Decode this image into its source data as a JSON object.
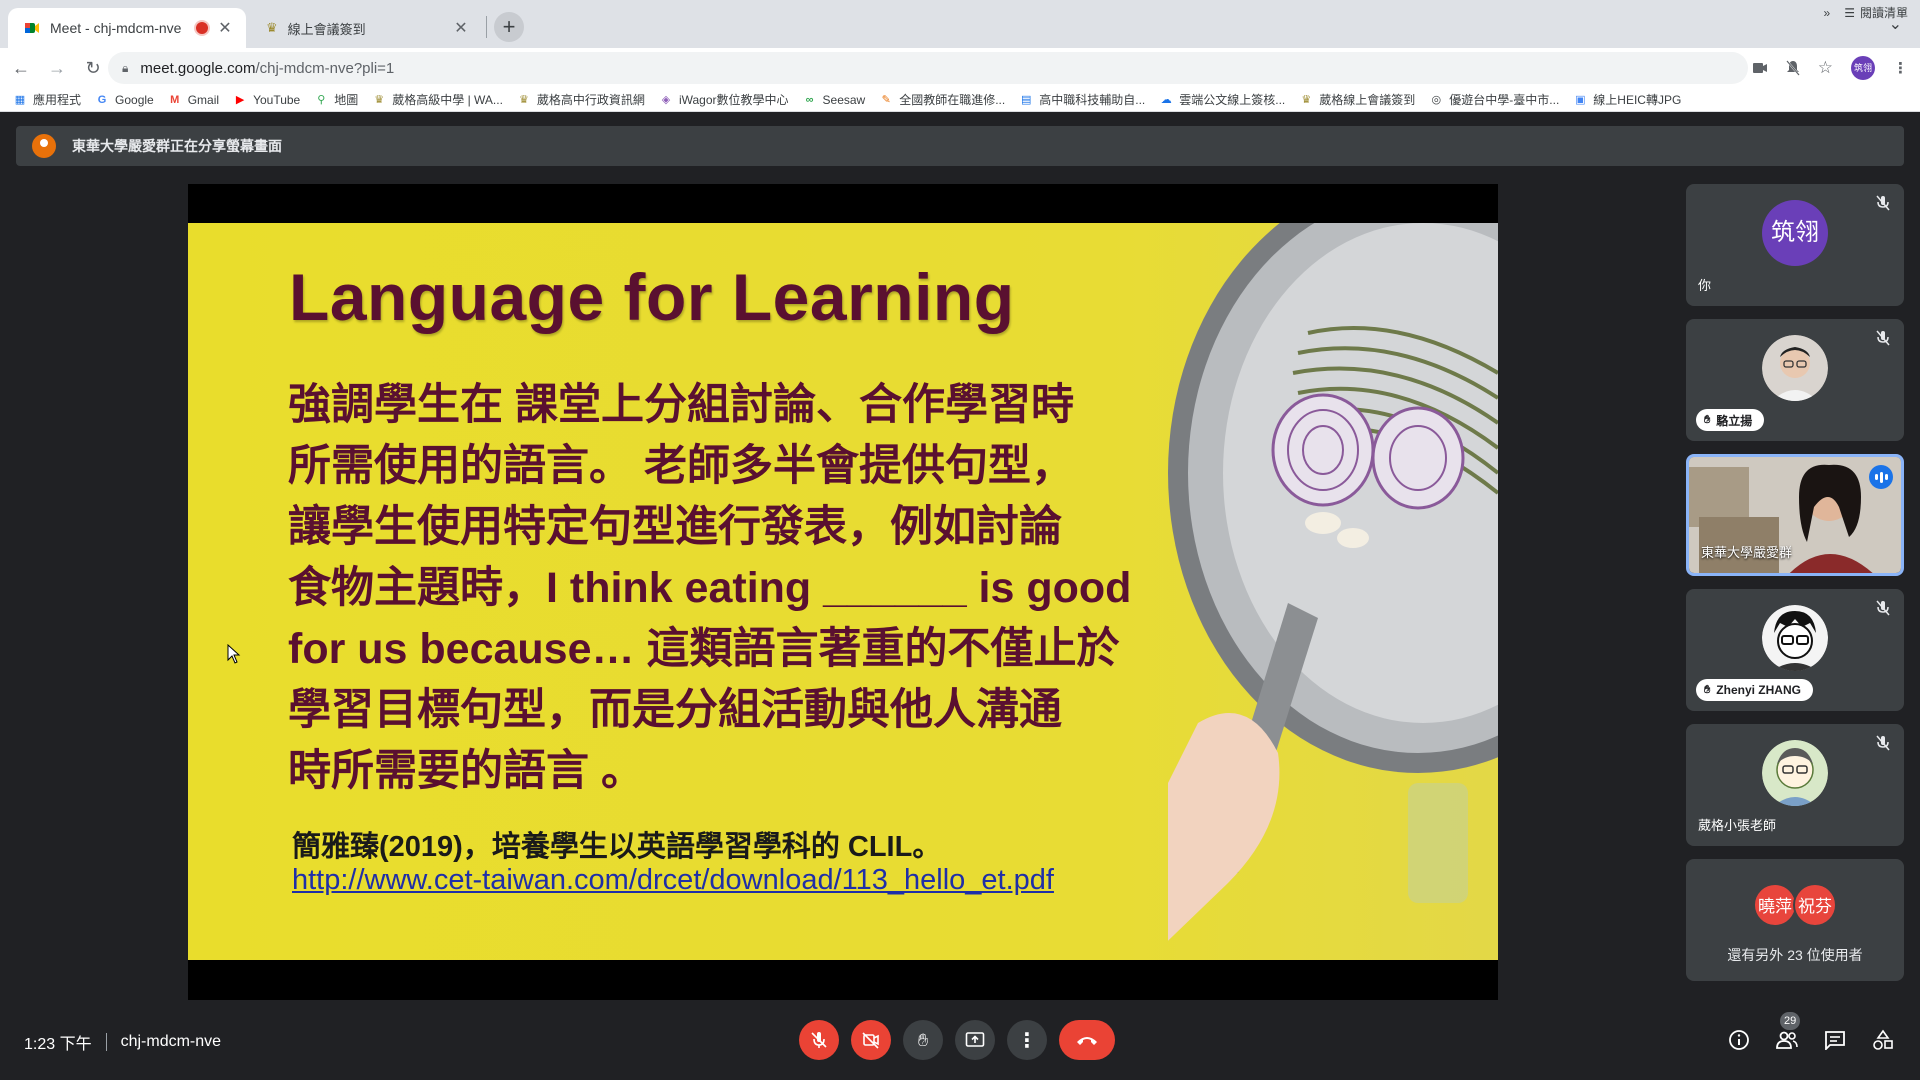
{
  "browser": {
    "tabs": [
      {
        "title": "Meet - chj-mdcm-nve",
        "active": true,
        "recording": true
      },
      {
        "title": "線上會議簽到",
        "active": false
      }
    ],
    "url_host": "meet.google.com",
    "url_path": "/chj-mdcm-nve?pli=1",
    "profile_label": "筑翎",
    "bookmarks": [
      {
        "label": "應用程式",
        "icon": "apps-grid-icon",
        "color": "#1a73e8"
      },
      {
        "label": "Google",
        "icon": "google-icon",
        "color": "#4285f4"
      },
      {
        "label": "Gmail",
        "icon": "gmail-icon",
        "color": "#ea4335"
      },
      {
        "label": "YouTube",
        "icon": "youtube-icon",
        "color": "#ff0000"
      },
      {
        "label": "地圖",
        "icon": "maps-icon",
        "color": "#34a853"
      },
      {
        "label": "葳格高級中學 | WA...",
        "icon": "school-icon",
        "color": "#9c8a2e"
      },
      {
        "label": "葳格高中行政資訊網",
        "icon": "school-icon",
        "color": "#9c8a2e"
      },
      {
        "label": "iWagor數位教學中心",
        "icon": "iwagor-icon",
        "color": "#8e5fb8"
      },
      {
        "label": "Seesaw",
        "icon": "seesaw-icon",
        "color": "#34a853"
      },
      {
        "label": "全國教師在職進修...",
        "icon": "teacher-icon",
        "color": "#e8710a"
      },
      {
        "label": "高中職科技輔助自...",
        "icon": "doc-icon",
        "color": "#1a73e8"
      },
      {
        "label": "雲端公文線上簽核...",
        "icon": "cloud-doc-icon",
        "color": "#1a73e8"
      },
      {
        "label": "葳格線上會議簽到",
        "icon": "school-icon",
        "color": "#9c8a2e"
      },
      {
        "label": "優遊台中學-臺中市...",
        "icon": "globe-icon",
        "color": "#3c4043"
      },
      {
        "label": "線上HEIC轉JPG",
        "icon": "image-convert-icon",
        "color": "#4285f4"
      }
    ],
    "more_bookmarks": "»",
    "reading_list": "閱讀清單"
  },
  "meet": {
    "presenting_banner": "東華大學嚴愛群正在分享螢幕畫面",
    "slide": {
      "title": "Language for Learning",
      "body": "強調學生在 課堂上分組討論、合作學習時\n所需使用的語言。 老師多半會提供句型，\n讓學生使用特定句型進行發表，例如討論\n食物主題時，I think eating ______ is good\nfor us because… 這類語言著重的不僅止於\n學習目標句型，而是分組活動與他人溝通\n時所需要的語言 。",
      "citation": "簡雅臻(2019)，培養學生以英語學習學科的 CLIL。",
      "link": "http://www.cet-taiwan.com/drcet/download/113_hello_et.pdf"
    },
    "participants": [
      {
        "name": "你",
        "avatar_text": "筑翎",
        "avatar_color": "#6a3fb8",
        "muted": true
      },
      {
        "name": "駱立揚",
        "hand_raised": true,
        "muted": true
      },
      {
        "name": "東華大學嚴愛群",
        "speaking": true,
        "video": true
      },
      {
        "name": "Zhenyi ZHANG",
        "hand_raised": true,
        "muted": true
      },
      {
        "name": "葳格小張老師",
        "muted": true
      }
    ],
    "others": {
      "avatars": [
        {
          "text": "曉萍"
        },
        {
          "text": "祝芬"
        }
      ],
      "label": "還有另外 23 位使用者"
    },
    "time": "1:23 下午",
    "meeting_code": "chj-mdcm-nve",
    "people_count": "29",
    "colors": {
      "danger": "#ea4335",
      "speaking": "#1a73e8",
      "slide_bg": "#e9dd2c",
      "slide_text": "#5a1030"
    }
  }
}
